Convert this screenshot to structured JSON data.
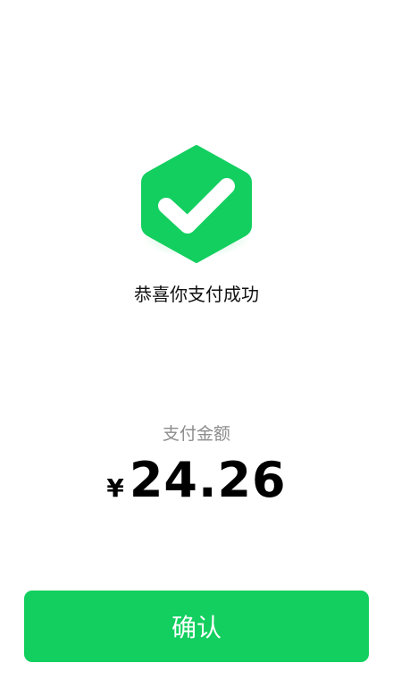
{
  "result": {
    "icon": "check-hexagon-icon",
    "title": "恭喜你支付成功"
  },
  "payment": {
    "label": "支付金额",
    "currency_symbol": "¥",
    "amount": "24.26"
  },
  "actions": {
    "confirm_label": "确认"
  },
  "colors": {
    "accent": "#12cf5f",
    "title_text": "#111111",
    "label_text": "#8c8c8c",
    "amount_text": "#000000"
  }
}
